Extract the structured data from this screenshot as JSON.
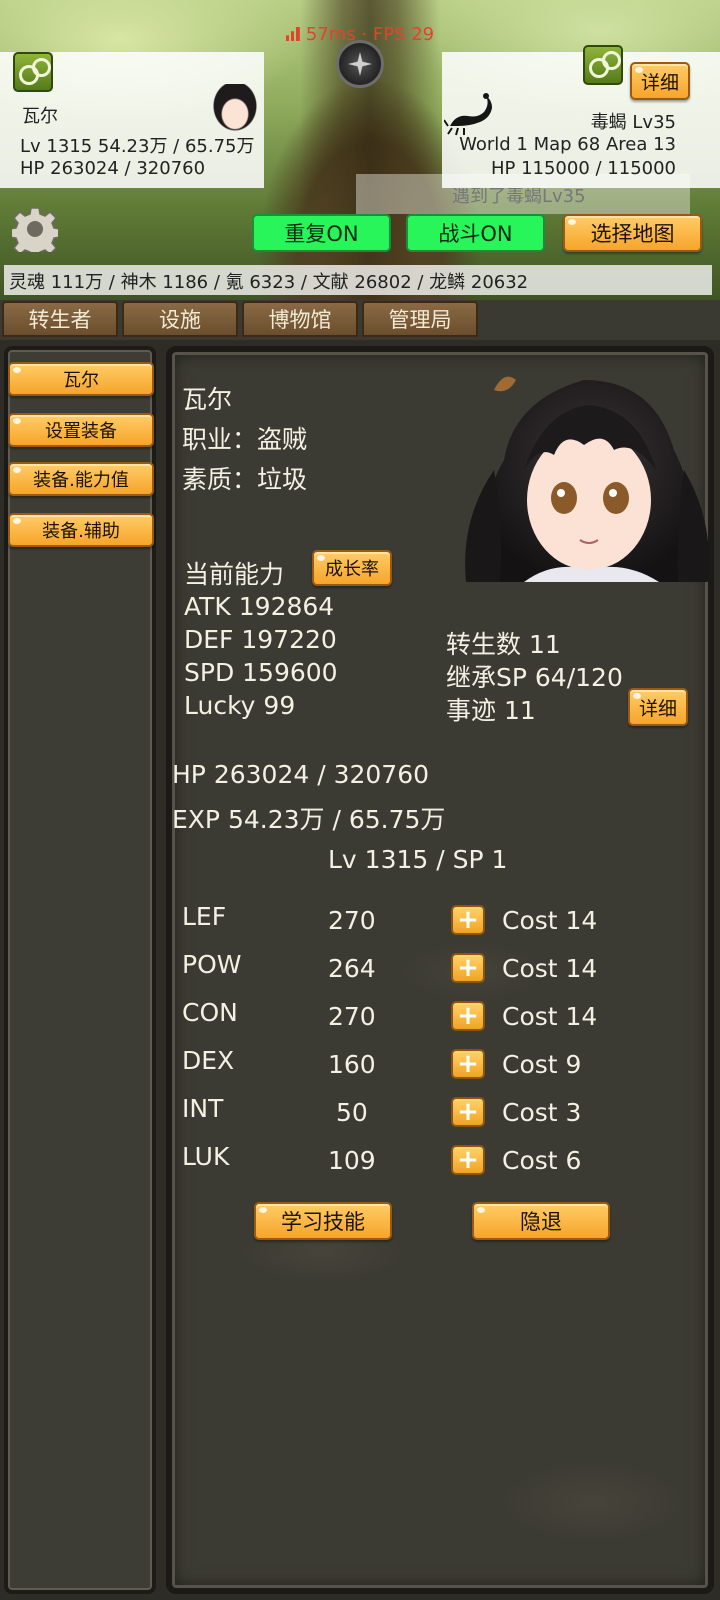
{
  "status": {
    "fps_text": "57ms · FPS 29"
  },
  "player": {
    "name": "瓦尔",
    "level_exp": "Lv 1315 54.23万 / 65.75万",
    "hp": "HP 263024 / 320760"
  },
  "enemy": {
    "detail_label": "详细",
    "name": "毒蝎 Lv35",
    "location": "World 1 Map 68 Area 13",
    "hp": "HP 115000 / 115000",
    "encounter_text": "遇到了毒蝎Lv35"
  },
  "controls": {
    "repeat_label": "重复ON",
    "battle_label": "战斗ON",
    "select_map_label": "选择地图"
  },
  "resources": "灵魂 111万 / 神木 1186 / 氪 6323 / 文献 26802 / 龙鳞 20632",
  "tabs": [
    "转生者",
    "设施",
    "博物馆",
    "管理局"
  ],
  "sidebar": [
    "瓦尔",
    "设置装备",
    "装备.能力值",
    "装备.辅助"
  ],
  "character": {
    "name": "瓦尔",
    "job": "职业：盗贼",
    "quality": "素质：垃圾",
    "current_ability": "当前能力",
    "growth_button": "成长率",
    "atk": "ATK 192864",
    "def": "DEF 197220",
    "spd": "SPD 159600",
    "lucky": "Lucky 99",
    "rebirth": "转生数 11",
    "inherit_sp": "继承SP 64/120",
    "deeds": "事迹 11",
    "detail_button": "详细",
    "hp": "HP 263024 / 320760",
    "exp": "EXP 54.23万 / 65.75万",
    "lv_sp": "Lv 1315 / SP 1"
  },
  "stats": [
    {
      "name": "LEF",
      "value": "270",
      "cost": "Cost 14"
    },
    {
      "name": "POW",
      "value": "264",
      "cost": "Cost 14"
    },
    {
      "name": "CON",
      "value": "270",
      "cost": "Cost 14"
    },
    {
      "name": "DEX",
      "value": "160",
      "cost": "Cost 9"
    },
    {
      "name": "INT",
      "value": "50",
      "cost": "Cost 3"
    },
    {
      "name": "LUK",
      "value": "109",
      "cost": "Cost 6"
    }
  ],
  "actions": {
    "learn_skill": "学习技能",
    "retire": "隐退"
  },
  "colors": {
    "accent_orange": "#f6a52c",
    "toggle_green": "#27f55a",
    "fps_red": "#e0452c"
  }
}
